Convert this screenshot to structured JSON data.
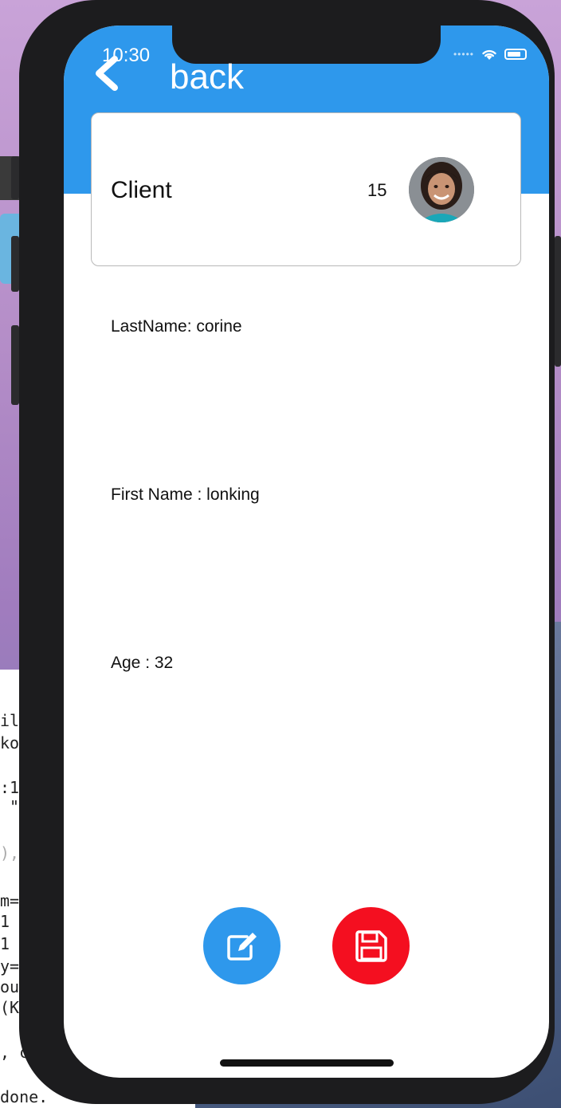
{
  "status_bar": {
    "time": "10:30"
  },
  "nav": {
    "back_label": "back"
  },
  "client_card": {
    "title": "Client",
    "count": "15"
  },
  "fields": {
    "last_name": "LastName:  corine",
    "first_name": "First Name : lonking",
    "age": "Age : 32"
  },
  "actions": {
    "edit_color": "#2e98ec",
    "save_color": "#f40f20"
  },
  "background_terminal": {
    "lines": [
      "il",
      "ko",
      ":1",
      " \"",
      "),",
      "m=",
      "1",
      "1",
      "y=",
      "ou",
      "(K",
      ", c",
      "done."
    ]
  },
  "colors": {
    "header": "#2e98ec",
    "phone_frame": "#1c1c1e"
  }
}
